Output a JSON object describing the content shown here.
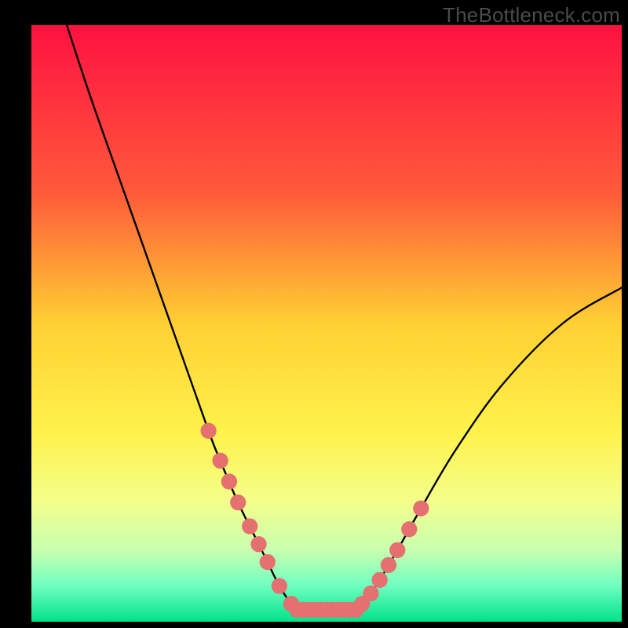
{
  "watermark": "TheBottleneck.com",
  "chart_data": {
    "type": "line",
    "title": "",
    "xlabel": "",
    "ylabel": "",
    "xlim": [
      0,
      100
    ],
    "ylim": [
      0,
      100
    ],
    "gradient_stops": [
      {
        "offset": 0,
        "color": "#ff1141"
      },
      {
        "offset": 28,
        "color": "#ff5a3a"
      },
      {
        "offset": 50,
        "color": "#ffd033"
      },
      {
        "offset": 68,
        "color": "#fff24a"
      },
      {
        "offset": 80,
        "color": "#f3ff8c"
      },
      {
        "offset": 88,
        "color": "#c8ffb0"
      },
      {
        "offset": 94,
        "color": "#6effc0"
      },
      {
        "offset": 100,
        "color": "#00e28a"
      }
    ],
    "series": [
      {
        "name": "left-branch",
        "x": [
          6,
          10,
          15,
          20,
          25,
          30,
          32,
          35,
          38,
          40,
          42,
          44,
          45
        ],
        "y": [
          100,
          88,
          74,
          60,
          46,
          32,
          27,
          20,
          14,
          10,
          6,
          3,
          2
        ]
      },
      {
        "name": "flat-segment",
        "x": [
          45,
          55
        ],
        "y": [
          2,
          2
        ]
      },
      {
        "name": "right-branch",
        "x": [
          55,
          57,
          59,
          62,
          66,
          72,
          80,
          90,
          100
        ],
        "y": [
          2,
          4,
          7,
          12,
          19,
          29,
          40,
          50,
          56
        ]
      }
    ],
    "markers_left": [
      30,
      32,
      33.5,
      35,
      37,
      38.5,
      40,
      42,
      44
    ],
    "markers_flat": [
      45,
      46,
      47,
      48,
      49,
      50,
      51,
      52,
      53,
      54,
      55
    ],
    "markers_right": [
      56,
      57.5,
      59,
      60.5,
      62,
      64,
      66
    ],
    "marker_color": "#e4706f",
    "marker_radius": 1.35
  }
}
